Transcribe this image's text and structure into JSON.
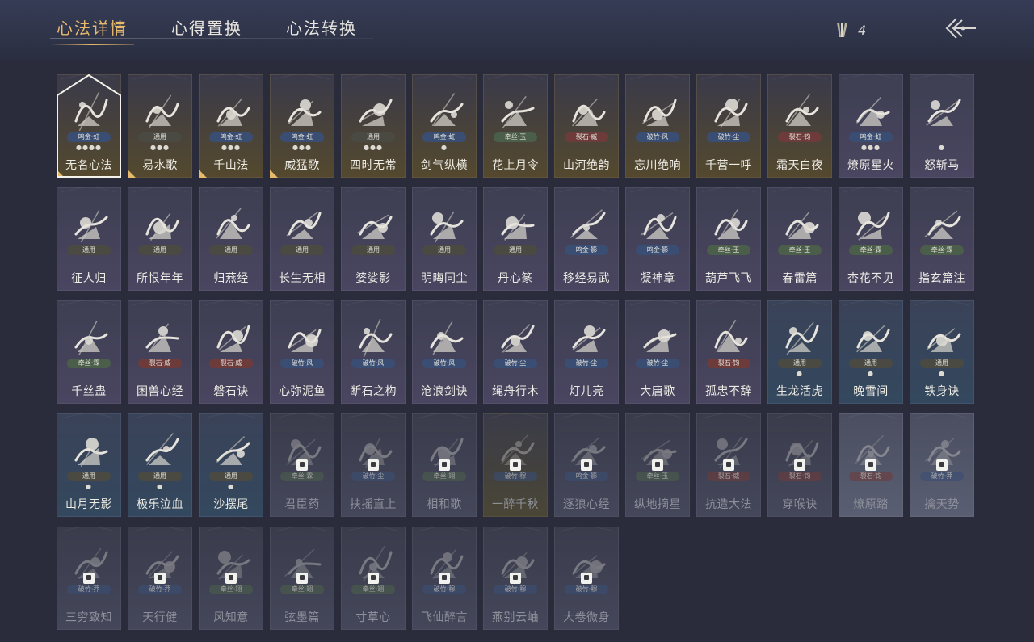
{
  "header": {
    "tabs": [
      {
        "label": "心法详情",
        "active": true
      },
      {
        "label": "心得置换",
        "active": false
      },
      {
        "label": "心法转换",
        "active": false
      }
    ],
    "currency": {
      "icon": "arrows-bundle-icon",
      "value": "4"
    },
    "back": {
      "icon": "back-arrow-icon"
    }
  },
  "colors": {
    "accent": "#e7b96b",
    "tag_gold": "#3a5878",
    "tag_green": "#4b5e4a",
    "tag_red": "#6e3b3b",
    "tag_blue": "#3a4e74",
    "tag_neutral": "#4a4a42"
  },
  "cards": [
    {
      "name": "无名心法",
      "tag": "鸣金·虹",
      "tagColor": "blue",
      "dots": "●●●●",
      "style": "gold",
      "selected": true,
      "corner": true,
      "icon": "spear-icon"
    },
    {
      "name": "易水歌",
      "tag": "通用",
      "tagColor": "neutral",
      "dots": "●●●",
      "style": "gold",
      "corner": true,
      "icon": "horse-icon"
    },
    {
      "name": "千山法",
      "tag": "鸣金·虹",
      "tagColor": "blue",
      "dots": "●●●",
      "style": "gold",
      "corner": true,
      "icon": "mountain-icon"
    },
    {
      "name": "威猛歌",
      "tag": "鸣金·虹",
      "tagColor": "blue",
      "dots": "●●●",
      "style": "gold",
      "corner": true,
      "icon": "fist-icon"
    },
    {
      "name": "四时无常",
      "tag": "通用",
      "tagColor": "neutral",
      "dots": "●●●",
      "style": "gold",
      "icon": "moon-branch-icon"
    },
    {
      "name": "剑气纵横",
      "tag": "鸣金·虹",
      "tagColor": "blue",
      "dots": "●",
      "style": "gold",
      "icon": "sword-icon"
    },
    {
      "name": "花上月令",
      "tag": "牵丝·玉",
      "tagColor": "green",
      "dots": "",
      "style": "gold",
      "icon": "flower-icon"
    },
    {
      "name": "山河绝韵",
      "tag": "裂石·威",
      "tagColor": "red",
      "dots": "",
      "style": "gold",
      "icon": "landscape-icon"
    },
    {
      "name": "忘川绝响",
      "tag": "破竹·风",
      "tagColor": "blue",
      "dots": "",
      "style": "gold",
      "icon": "mask-icon"
    },
    {
      "name": "千营一呼",
      "tag": "破竹·尘",
      "tagColor": "blue",
      "dots": "",
      "style": "gold",
      "icon": "banner-icon"
    },
    {
      "name": "霜天白夜",
      "tag": "裂石·钧",
      "tagColor": "red",
      "dots": "",
      "style": "gold",
      "icon": "staff-icon"
    },
    {
      "name": "燎原星火",
      "tag": "鸣金·虹",
      "tagColor": "blue",
      "dots": "●●●",
      "style": "purple",
      "icon": "blade-icon"
    },
    {
      "name": "怒斩马",
      "tag": "",
      "tagColor": "neutral",
      "dots": "●",
      "style": "purple",
      "icon": "broadsword-icon"
    },
    {
      "name": "征人归",
      "tag": "通用",
      "tagColor": "neutral",
      "dots": "",
      "style": "purple",
      "icon": "bird-hand-icon"
    },
    {
      "name": "所恨年年",
      "tag": "通用",
      "tagColor": "neutral",
      "dots": "",
      "style": "purple",
      "icon": "bamboo-icon"
    },
    {
      "name": "归燕经",
      "tag": "通用",
      "tagColor": "neutral",
      "dots": "",
      "style": "purple",
      "icon": "swallow-icon"
    },
    {
      "name": "长生无相",
      "tag": "通用",
      "tagColor": "neutral",
      "dots": "",
      "style": "purple",
      "icon": "deity-icon"
    },
    {
      "name": "婆娑影",
      "tag": "通用",
      "tagColor": "neutral",
      "dots": "",
      "style": "purple",
      "icon": "dragon-icon"
    },
    {
      "name": "明晦同尘",
      "tag": "通用",
      "tagColor": "neutral",
      "dots": "",
      "style": "purple",
      "icon": "knot-icon"
    },
    {
      "name": "丹心篆",
      "tag": "通用",
      "tagColor": "neutral",
      "dots": "",
      "style": "purple",
      "icon": "seal-icon"
    },
    {
      "name": "移经易武",
      "tag": "鸣金·影",
      "tagColor": "blue",
      "dots": "",
      "style": "purple",
      "icon": "armor-icon"
    },
    {
      "name": "凝神章",
      "tag": "鸣金·影",
      "tagColor": "blue",
      "dots": "",
      "style": "purple",
      "icon": "bow-icon"
    },
    {
      "name": "葫芦飞飞",
      "tag": "牵丝·玉",
      "tagColor": "green",
      "dots": "",
      "style": "purple",
      "icon": "gourd-icon"
    },
    {
      "name": "春雷篇",
      "tag": "牵丝·玉",
      "tagColor": "green",
      "dots": "",
      "style": "purple",
      "icon": "tree-icon"
    },
    {
      "name": "杏花不见",
      "tag": "牵丝·霖",
      "tagColor": "green",
      "dots": "",
      "style": "purple",
      "icon": "blossom-icon"
    },
    {
      "name": "指玄篇注",
      "tag": "牵丝·霖",
      "tagColor": "green",
      "dots": "",
      "style": "purple",
      "icon": "yinyang-icon"
    },
    {
      "name": "千丝蛊",
      "tag": "牵丝·霖",
      "tagColor": "green",
      "dots": "",
      "style": "purple",
      "icon": "leaf-icon"
    },
    {
      "name": "困兽心经",
      "tag": "裂石·威",
      "tagColor": "red",
      "dots": "",
      "style": "purple",
      "icon": "drum-icon"
    },
    {
      "name": "磐石诀",
      "tag": "裂石·威",
      "tagColor": "red",
      "dots": "",
      "style": "purple",
      "icon": "rock-icon"
    },
    {
      "name": "心弥泥鱼",
      "tag": "破竹·风",
      "tagColor": "blue",
      "dots": "",
      "style": "purple",
      "icon": "fish-icon"
    },
    {
      "name": "断石之构",
      "tag": "破竹·风",
      "tagColor": "blue",
      "dots": "",
      "style": "purple",
      "icon": "warrior-icon"
    },
    {
      "name": "沧浪剑诀",
      "tag": "破竹·风",
      "tagColor": "blue",
      "dots": "",
      "style": "purple",
      "icon": "serpent-icon"
    },
    {
      "name": "绳舟行木",
      "tag": "破竹·尘",
      "tagColor": "blue",
      "dots": "",
      "style": "purple",
      "icon": "tentacle-icon"
    },
    {
      "name": "灯儿亮",
      "tag": "破竹·尘",
      "tagColor": "blue",
      "dots": "",
      "style": "purple",
      "icon": "dagger-icon"
    },
    {
      "name": "大唐歌",
      "tag": "破竹·尘",
      "tagColor": "blue",
      "dots": "",
      "style": "purple",
      "icon": "wall-icon"
    },
    {
      "name": "孤忠不辞",
      "tag": "裂石·钧",
      "tagColor": "red",
      "dots": "",
      "style": "purple",
      "icon": "crossed-blades-icon"
    },
    {
      "name": "生龙活虎",
      "tag": "通用",
      "tagColor": "neutral",
      "dots": "●",
      "style": "teal",
      "icon": "swirl-icon"
    },
    {
      "name": "晚雪间",
      "tag": "通用",
      "tagColor": "neutral",
      "dots": "●",
      "style": "teal",
      "icon": "cross-circle-icon"
    },
    {
      "name": "铁身诀",
      "tag": "通用",
      "tagColor": "neutral",
      "dots": "●",
      "style": "teal",
      "icon": "muscle-icon"
    },
    {
      "name": "山月无影",
      "tag": "通用",
      "tagColor": "neutral",
      "dots": "●",
      "style": "teal",
      "icon": "claw-icon"
    },
    {
      "name": "极乐泣血",
      "tag": "通用",
      "tagColor": "neutral",
      "dots": "●",
      "style": "teal",
      "icon": "slash-icon"
    },
    {
      "name": "沙摆尾",
      "tag": "通用",
      "tagColor": "neutral",
      "dots": "●",
      "style": "teal",
      "icon": "feather-icon"
    },
    {
      "name": "君臣药",
      "tag": "牵丝·霖",
      "tagColor": "green",
      "dots": "",
      "style": "locked",
      "locked": true,
      "icon": "herb-icon"
    },
    {
      "name": "扶摇直上",
      "tag": "破竹·尘",
      "tagColor": "blue",
      "dots": "",
      "style": "locked",
      "locked": true,
      "icon": "eagle-icon"
    },
    {
      "name": "相和歌",
      "tag": "牵丝·翊",
      "tagColor": "green",
      "dots": "",
      "style": "locked",
      "locked": true,
      "icon": "mask-dance-icon"
    },
    {
      "name": "一醉千秋",
      "tag": "破竹·穆",
      "tagColor": "blue",
      "dots": "",
      "style": "locked-gold",
      "locked": true,
      "icon": "wine-icon"
    },
    {
      "name": "逐狼心经",
      "tag": "鸣金·影",
      "tagColor": "blue",
      "dots": "",
      "style": "locked",
      "locked": true,
      "icon": "wolf-icon"
    },
    {
      "name": "纵地摘星",
      "tag": "牵丝·玉",
      "tagColor": "green",
      "dots": "",
      "style": "locked",
      "locked": true,
      "icon": "stars-icon"
    },
    {
      "name": "抗造大法",
      "tag": "裂石·威",
      "tagColor": "red",
      "dots": "",
      "style": "locked",
      "locked": true,
      "icon": "bell-icon"
    },
    {
      "name": "穿喉诀",
      "tag": "裂石·钧",
      "tagColor": "red",
      "dots": "",
      "style": "locked",
      "locked": true,
      "icon": "skull-icon"
    },
    {
      "name": "燎原踏",
      "tag": "裂石·钧",
      "tagColor": "red",
      "dots": "",
      "style": "locked-light",
      "locked": true,
      "icon": "flame-icon"
    },
    {
      "name": "擒天势",
      "tag": "破竹·莽",
      "tagColor": "blue",
      "dots": "",
      "style": "locked-light",
      "locked": true,
      "icon": "chain-icon"
    },
    {
      "name": "三穷致知",
      "tag": "破竹·莽",
      "tagColor": "blue",
      "dots": "",
      "style": "locked",
      "locked": true,
      "icon": "scroll-icon"
    },
    {
      "name": "天行健",
      "tag": "破竹·莽",
      "tagColor": "blue",
      "dots": "",
      "style": "locked",
      "locked": true,
      "icon": "hat-icon"
    },
    {
      "name": "风知意",
      "tag": "牵丝·翊",
      "tagColor": "green",
      "dots": "",
      "style": "locked",
      "locked": true,
      "icon": "shrimp-icon"
    },
    {
      "name": "弦墨篇",
      "tag": "牵丝·翊",
      "tagColor": "green",
      "dots": "",
      "style": "locked",
      "locked": true,
      "icon": "brush-icon"
    },
    {
      "name": "寸草心",
      "tag": "牵丝·翊",
      "tagColor": "green",
      "dots": "",
      "style": "locked",
      "locked": true,
      "icon": "sprout-icon"
    },
    {
      "name": "飞仙醉言",
      "tag": "破竹·穆",
      "tagColor": "blue",
      "dots": "",
      "style": "locked",
      "locked": true,
      "icon": "flute-icon"
    },
    {
      "name": "燕别云岫",
      "tag": "破竹·穆",
      "tagColor": "blue",
      "dots": "",
      "style": "locked",
      "locked": true,
      "icon": "bird-flight-icon"
    },
    {
      "name": "大卷微身",
      "tag": "破竹·穆",
      "tagColor": "blue",
      "dots": "",
      "style": "locked",
      "locked": true,
      "icon": "ribbon-icon"
    }
  ]
}
